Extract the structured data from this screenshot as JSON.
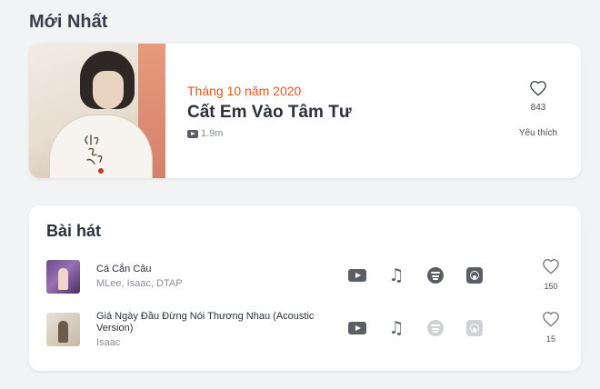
{
  "section": {
    "title": "Mới Nhất"
  },
  "featured": {
    "date": "Tháng 10 năm 2020",
    "title": "Cất Em Vào Tâm Tư",
    "views": "1.9m",
    "likes": "843",
    "like_label": "Yêu thích",
    "cover_text": "Cất Em Vào Tâm Tư",
    "icons": {
      "views": "youtube-icon",
      "like": "heart-icon"
    }
  },
  "songs": {
    "title": "Bài hát",
    "items": [
      {
        "name": "Cá Cắn Câu",
        "artist": "MLee, Isaac, DTAP",
        "likes": "150",
        "platforms": [
          "youtube-icon",
          "music-note-icon",
          "spotify-icon",
          "apple-music-icon"
        ]
      },
      {
        "name": "Giá Ngày Đầu Đừng Nói Thương Nhau (Acoustic Version)",
        "artist": "Isaac",
        "likes": "15",
        "platforms": [
          "youtube-icon",
          "music-note-icon",
          "spotify-icon-disabled",
          "apple-music-icon-disabled"
        ]
      }
    ]
  },
  "colors": {
    "background": "#f2f3f5",
    "accent": "#e2571b",
    "icon": "#5c5e66",
    "icon_disabled": "#d0d1d5"
  }
}
